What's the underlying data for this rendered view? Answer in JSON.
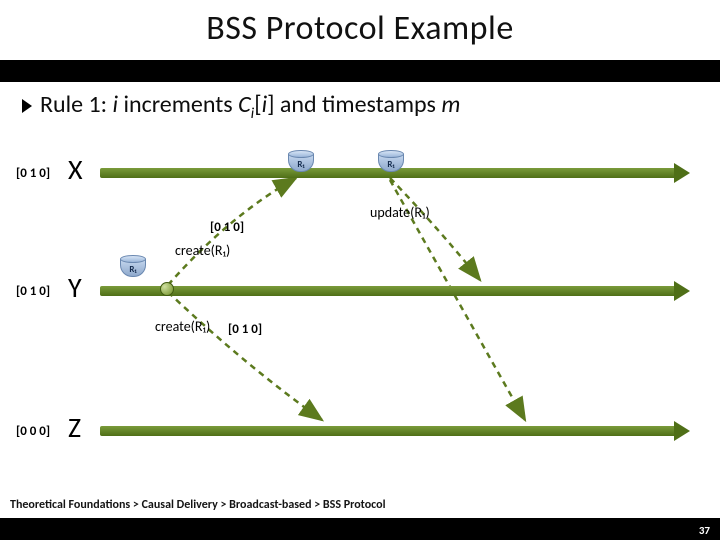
{
  "title": "BSS Protocol Example",
  "rule": {
    "prefix": "Rule 1: ",
    "i1": "i",
    "mid1": " increments ",
    "ci": "C",
    "ci_sub": "i",
    "bracket_i": "i",
    "mid2": " and timestamps ",
    "m": "m"
  },
  "processes": {
    "x": {
      "ts": "[0 1 0]",
      "label": "X"
    },
    "y": {
      "ts": "[0 1 0]",
      "label": "Y"
    },
    "z": {
      "ts": "[0 0 0]",
      "label": "Z"
    }
  },
  "replica_label": "R₁",
  "labels": {
    "ts_above_create": "[0 1 0]",
    "create_r1": "create(R₁)",
    "create_r1_2": "create(R₁)",
    "ts_after_create_z": "[0 1 0]",
    "update_r1": "update(R₁)"
  },
  "breadcrumb": "Theoretical Foundations > Causal Delivery > Broadcast-based > BSS Protocol",
  "page": "37"
}
